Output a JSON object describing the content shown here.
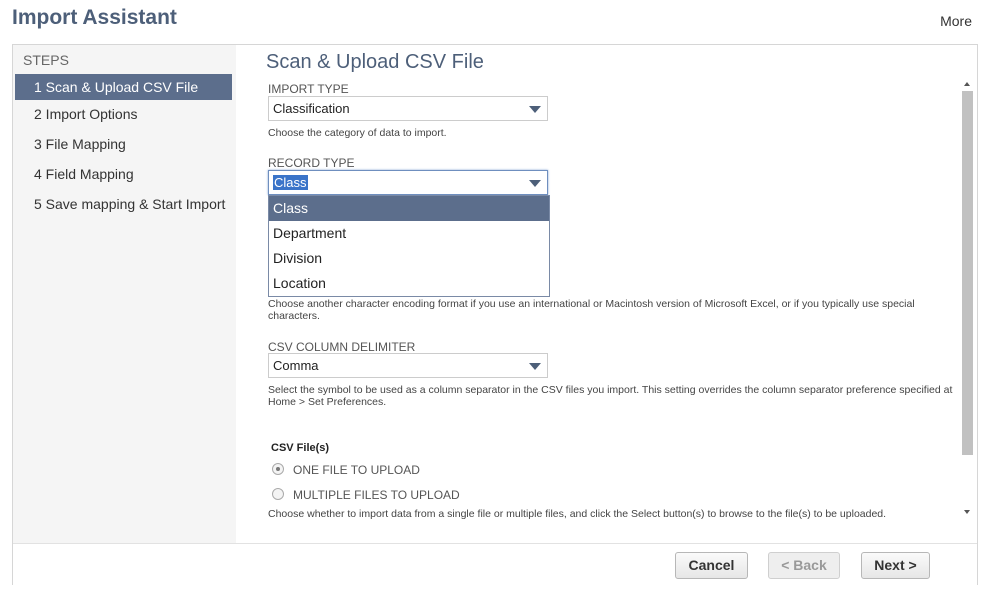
{
  "header": {
    "title": "Import Assistant",
    "more_label": "More"
  },
  "steps": {
    "heading": "STEPS",
    "items": [
      {
        "label": "1 Scan & Upload CSV File",
        "active": true
      },
      {
        "label": "2 Import Options"
      },
      {
        "label": "3 File Mapping"
      },
      {
        "label": "4 Field Mapping"
      },
      {
        "label": "5 Save mapping & Start Import"
      }
    ]
  },
  "main": {
    "title": "Scan & Upload CSV File",
    "import_type": {
      "label": "IMPORT TYPE",
      "value": "Classification",
      "help": "Choose the category of data to import."
    },
    "record_type": {
      "label": "RECORD TYPE",
      "value": "Class",
      "options": [
        "Class",
        "Department",
        "Division",
        "Location"
      ],
      "selected_option": "Class"
    },
    "encoding_help": "Choose another character encoding format if you use an international or Macintosh version of Microsoft Excel, or if you typically use special characters.",
    "delimiter": {
      "label": "CSV COLUMN DELIMITER",
      "value": "Comma",
      "help": "Select the symbol to be used as a column separator in the CSV files you import. This setting overrides the column separator preference specified at Home > Set Preferences."
    },
    "csv_files": {
      "label": "CSV File(s)",
      "options": [
        {
          "label": "ONE FILE TO UPLOAD",
          "checked": true
        },
        {
          "label": "MULTIPLE FILES TO UPLOAD",
          "checked": false
        }
      ],
      "help": "Choose whether to import data from a single file or multiple files, and click the Select button(s) to browse to the file(s) to be uploaded."
    }
  },
  "footer": {
    "cancel_label": "Cancel",
    "back_label": "< Back",
    "next_label": "Next >"
  },
  "colors": {
    "accent": "#5c6e8c",
    "title": "#4d5f79",
    "selection": "#3a74c9"
  }
}
